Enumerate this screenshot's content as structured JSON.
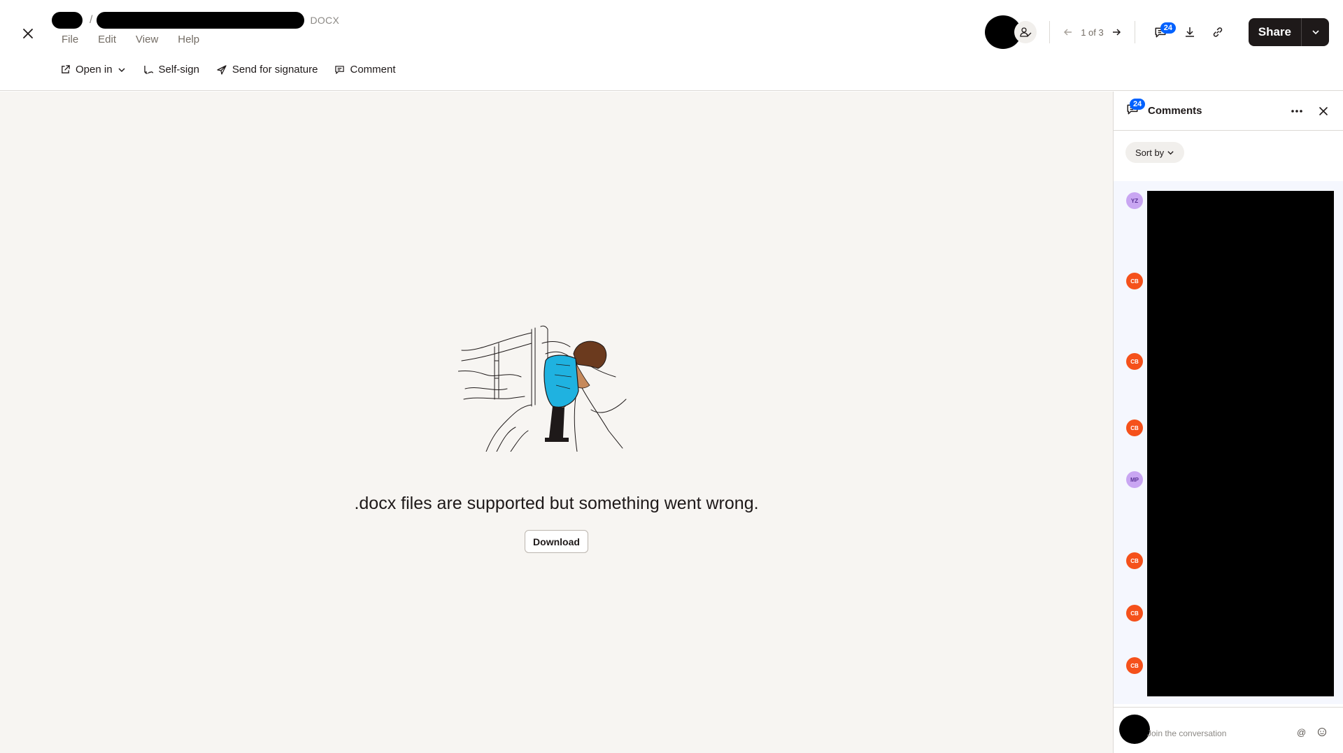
{
  "header": {
    "file_ext": "DOCX",
    "menu": [
      "File",
      "Edit",
      "View",
      "Help"
    ],
    "toolbar": {
      "open_in": "Open in",
      "self_sign": "Self-sign",
      "send_for_signature": "Send for signature",
      "comment": "Comment"
    },
    "pager": "1 of 3",
    "comments_count": "24",
    "share_label": "Share"
  },
  "main": {
    "error_message": ".docx files are supported but something went wrong.",
    "download_label": "Download"
  },
  "comments_panel": {
    "badge": "24",
    "title": "Comments",
    "sort_label": "Sort by",
    "avatars": [
      "YZ",
      "CB",
      "CB",
      "CB",
      "MP",
      "CB",
      "CB",
      "CB"
    ],
    "input_placeholder": "Join the conversation",
    "mention_symbol": "@"
  },
  "colors": {
    "accent": "#0061fe",
    "share_button": "#1e1919",
    "avatar_orange": "#f5511b",
    "avatar_purple": "#c9a6f2"
  }
}
